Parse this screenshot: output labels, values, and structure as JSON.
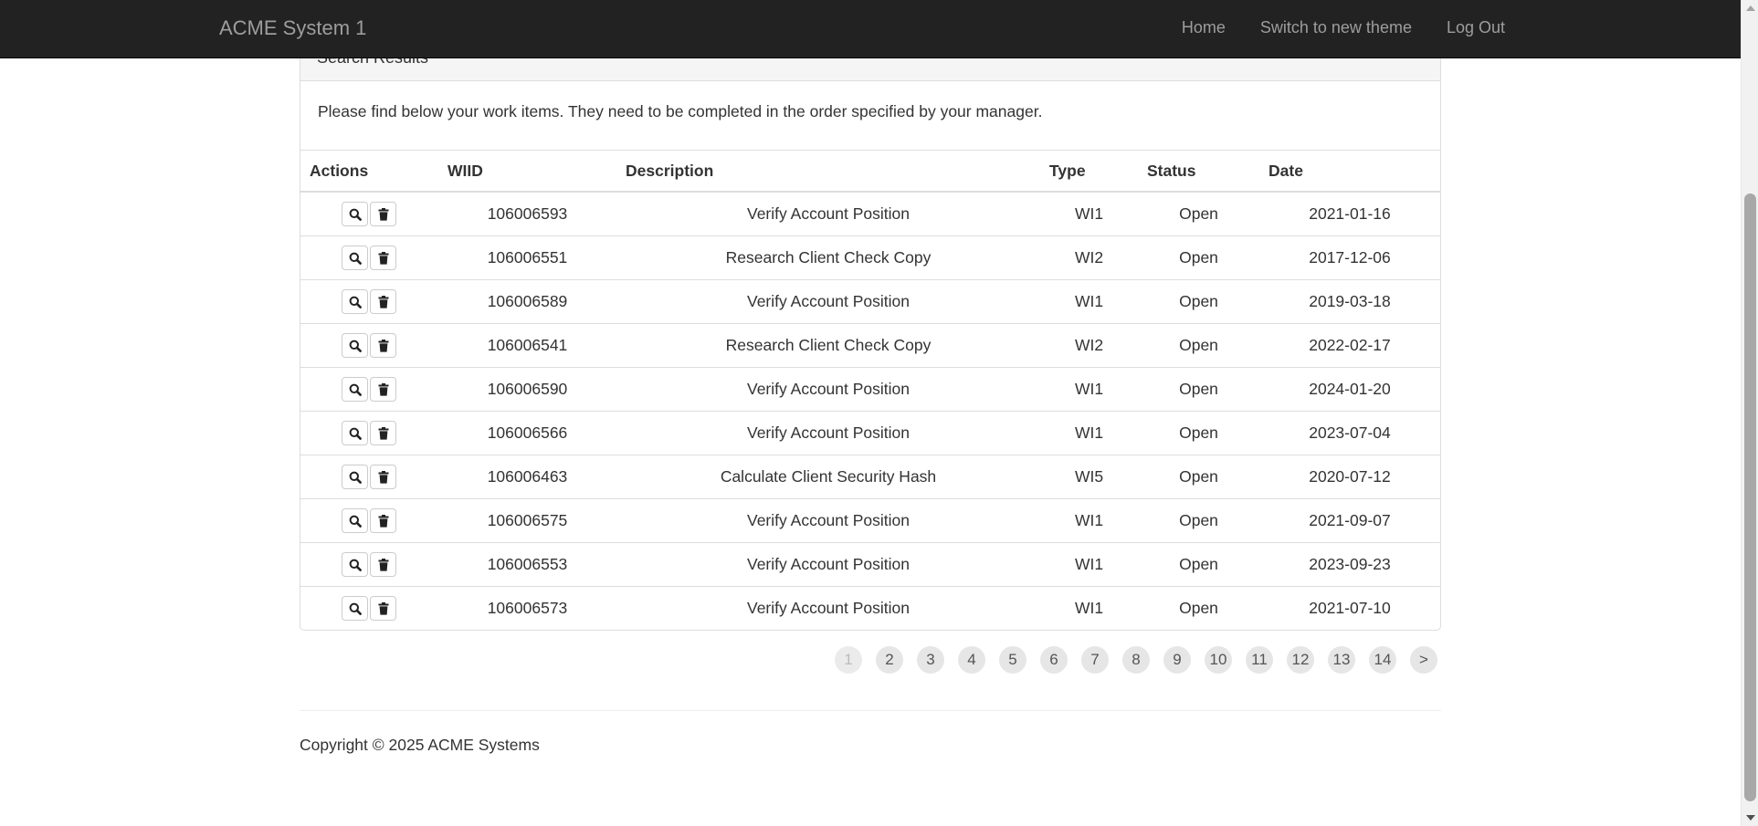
{
  "navbar": {
    "brand": "ACME System 1",
    "links": [
      "Home",
      "Switch to new theme",
      "Log Out"
    ]
  },
  "panel": {
    "heading": "Search Results",
    "intro": "Please find below your work items. They need to be completed in the order specified by your manager."
  },
  "table": {
    "headers": [
      "Actions",
      "WIID",
      "Description",
      "Type",
      "Status",
      "Date"
    ],
    "rows": [
      {
        "wiid": "106006593",
        "description": "Verify Account Position",
        "type": "WI1",
        "status": "Open",
        "date": "2021-01-16"
      },
      {
        "wiid": "106006551",
        "description": "Research Client Check Copy",
        "type": "WI2",
        "status": "Open",
        "date": "2017-12-06"
      },
      {
        "wiid": "106006589",
        "description": "Verify Account Position",
        "type": "WI1",
        "status": "Open",
        "date": "2019-03-18"
      },
      {
        "wiid": "106006541",
        "description": "Research Client Check Copy",
        "type": "WI2",
        "status": "Open",
        "date": "2022-02-17"
      },
      {
        "wiid": "106006590",
        "description": "Verify Account Position",
        "type": "WI1",
        "status": "Open",
        "date": "2024-01-20"
      },
      {
        "wiid": "106006566",
        "description": "Verify Account Position",
        "type": "WI1",
        "status": "Open",
        "date": "2023-07-04"
      },
      {
        "wiid": "106006463",
        "description": "Calculate Client Security Hash",
        "type": "WI5",
        "status": "Open",
        "date": "2020-07-12"
      },
      {
        "wiid": "106006575",
        "description": "Verify Account Position",
        "type": "WI1",
        "status": "Open",
        "date": "2021-09-07"
      },
      {
        "wiid": "106006553",
        "description": "Verify Account Position",
        "type": "WI1",
        "status": "Open",
        "date": "2023-09-23"
      },
      {
        "wiid": "106006573",
        "description": "Verify Account Position",
        "type": "WI1",
        "status": "Open",
        "date": "2021-07-10"
      }
    ],
    "row_icons": [
      "search-icon",
      "trash-icon"
    ]
  },
  "pagination": {
    "pages": [
      "1",
      "2",
      "3",
      "4",
      "5",
      "6",
      "7",
      "8",
      "9",
      "10",
      "11",
      "12",
      "13",
      "14",
      ">"
    ],
    "current": "1"
  },
  "footer": {
    "copyright": "Copyright © 2025 ACME Systems"
  },
  "colors": {
    "navbar_bg": "#222222",
    "navbar_text": "#9d9d9d",
    "border": "#dddddd"
  }
}
